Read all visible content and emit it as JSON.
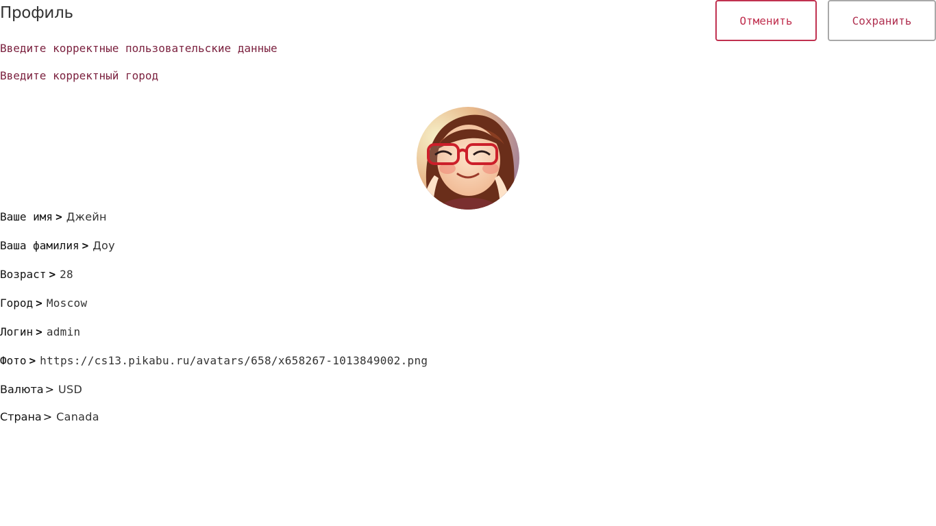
{
  "header": {
    "title": "Профиль",
    "cancel_label": "Отменить",
    "save_label": "Сохранить",
    "cancel_color": "#c0304f",
    "save_border_color": "#a8a8a8"
  },
  "errors": {
    "user_data": "Введите корректные пользовательские данные",
    "city": "Введите корректный город",
    "color": "#7a1f3d"
  },
  "avatar": {
    "icon": "avatar-photo"
  },
  "fields": {
    "first_name": {
      "label": "Ваше имя",
      "arrow": ">",
      "value": "Джейн"
    },
    "last_name": {
      "label": "Ваша фамилия",
      "arrow": ">",
      "value": "Доу"
    },
    "age": {
      "label": "Возраст",
      "arrow": ">",
      "value": "28"
    },
    "city": {
      "label": "Город",
      "arrow": ">",
      "value": "Moscow"
    },
    "login": {
      "label": "Логин",
      "arrow": ">",
      "value": "admin"
    },
    "photo": {
      "label": "Фото",
      "arrow": ">",
      "value": "https://cs13.pikabu.ru/avatars/658/x658267-1013849002.png"
    },
    "currency": {
      "label": "Валюта",
      "arrow": ">",
      "value": "USD"
    },
    "country": {
      "label": "Страна",
      "arrow": ">",
      "value": "Canada"
    }
  }
}
